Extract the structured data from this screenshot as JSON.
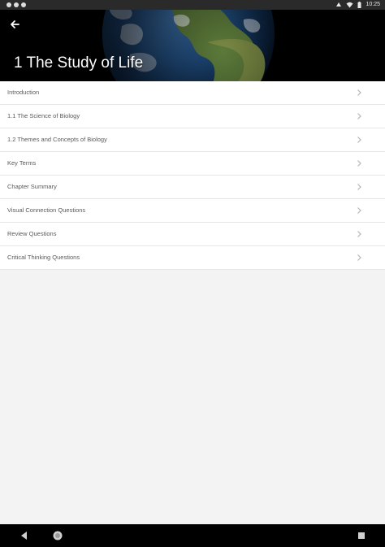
{
  "status_bar": {
    "time": "10:25"
  },
  "header": {
    "title": "1 The Study of Life",
    "back_icon": "arrow-left-icon"
  },
  "toc": {
    "items": [
      {
        "label": "Introduction"
      },
      {
        "label": "1.1 The Science of Biology"
      },
      {
        "label": "1.2 Themes and Concepts of Biology"
      },
      {
        "label": "Key Terms"
      },
      {
        "label": "Chapter Summary"
      },
      {
        "label": "Visual Connection Questions"
      },
      {
        "label": "Review Questions"
      },
      {
        "label": "Critical Thinking Questions"
      }
    ],
    "chevron_icon": "chevron-right-icon"
  },
  "nav_bar": {
    "back_icon": "triangle-back-icon",
    "home_icon": "home-circle-icon",
    "recents_icon": "square-recents-icon"
  },
  "colors": {
    "header_bg": "#000000",
    "list_bg": "#ffffff",
    "page_bg": "#f3f3f3",
    "divider": "#e6e6e6",
    "item_text": "#5a5a5a"
  }
}
